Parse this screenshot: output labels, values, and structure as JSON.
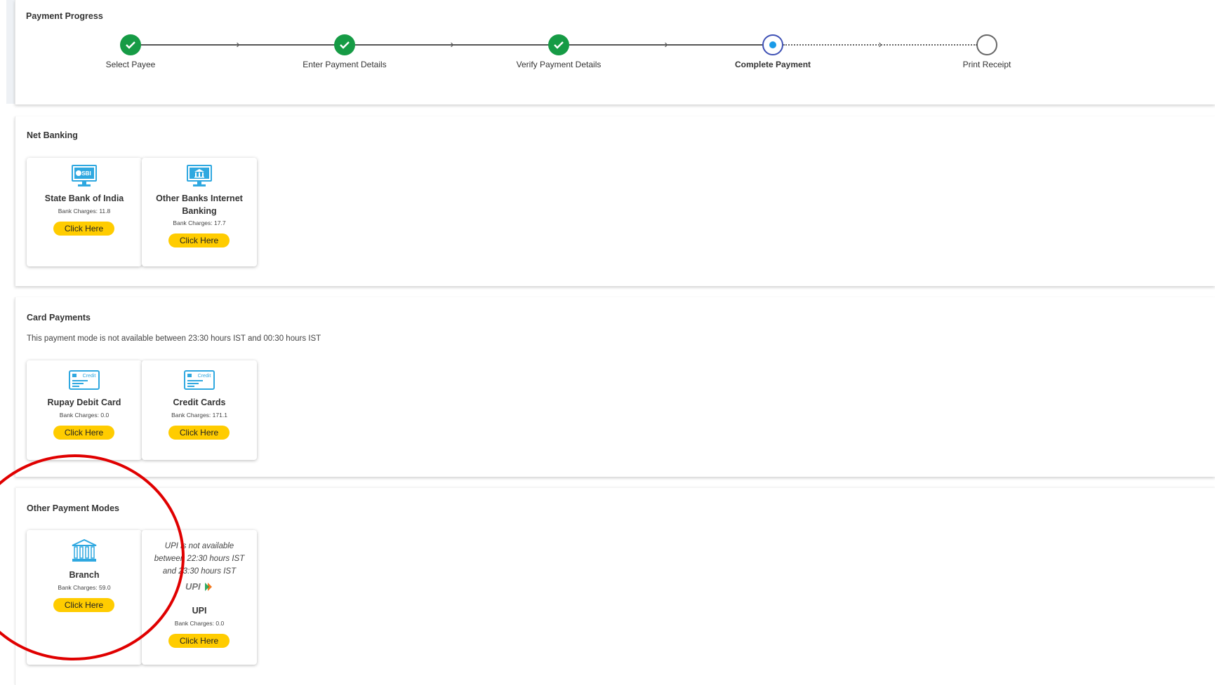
{
  "progress": {
    "title": "Payment Progress",
    "steps": [
      {
        "label": "Select Payee",
        "state": "done"
      },
      {
        "label": "Enter Payment Details",
        "state": "done"
      },
      {
        "label": "Verify Payment Details",
        "state": "done"
      },
      {
        "label": "Complete Payment",
        "state": "current"
      },
      {
        "label": "Print Receipt",
        "state": "pending"
      }
    ]
  },
  "net_banking": {
    "title": "Net Banking",
    "cards": [
      {
        "name": "State Bank of India",
        "charges": "Bank Charges: 11.8",
        "button": "Click Here",
        "icon": "sbi-monitor-icon",
        "icon_logo_text": "SBI"
      },
      {
        "name": "Other Banks Internet Banking",
        "charges": "Bank Charges: 17.7",
        "button": "Click Here",
        "icon": "bank-monitor-icon"
      }
    ]
  },
  "card_payments": {
    "title": "Card Payments",
    "notice": "This payment mode is not available between 23:30 hours IST and 00:30 hours IST",
    "cards": [
      {
        "name": "Rupay Debit Card",
        "charges": "Bank Charges: 0.0",
        "button": "Click Here",
        "icon": "card-icon",
        "icon_card_text": "Credit"
      },
      {
        "name": "Credit Cards",
        "charges": "Bank Charges: 171.1",
        "button": "Click Here",
        "icon": "card-icon",
        "icon_card_text": "Credit"
      }
    ]
  },
  "other_modes": {
    "title": "Other Payment Modes",
    "cards": [
      {
        "name": "Branch",
        "charges": "Bank Charges: 59.0",
        "button": "Click Here",
        "icon": "bank-building-icon"
      },
      {
        "name": "UPI",
        "charges": "Bank Charges: 0.0",
        "button": "Click Here",
        "icon": "upi-logo-icon",
        "icon_logo_text": "UPI",
        "note": "UPI is not available between 22:30 hours IST and 23:30 hours IST"
      }
    ]
  },
  "colors": {
    "step_done": "#169b45",
    "step_current_ring": "#3f51b5",
    "step_current_dot": "#1a9be8",
    "button": "#ffcc00",
    "icon_blue": "#2fa8e0",
    "annotation": "#e00000"
  }
}
